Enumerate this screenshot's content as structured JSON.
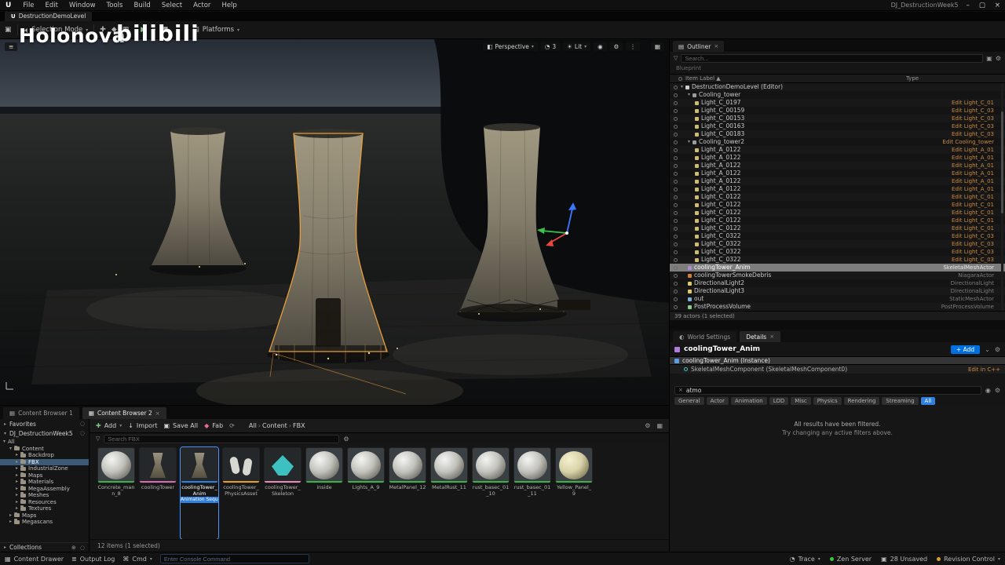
{
  "colors": {
    "accent": "#0070e0",
    "link_orange": "#cd8a3e",
    "selection_outline": "#f0a23c"
  },
  "menu_bar": {
    "items": [
      "File",
      "Edit",
      "Window",
      "Tools",
      "Build",
      "Select",
      "Actor",
      "Help"
    ],
    "project_label": "DJ_DestructionWeek5"
  },
  "level_tab": {
    "label": "DestructionDemoLevel"
  },
  "toolbar": {
    "selection_mode": "Selection Mode",
    "platforms": "Platforms"
  },
  "watermarks": {
    "left": "Holonova",
    "right": "bilibili"
  },
  "viewport": {
    "perspective": "Perspective",
    "camera_speed": "3",
    "lit": "Lit"
  },
  "outliner": {
    "tab": "Outliner",
    "search_placeholder": "Search...",
    "hint": "Blueprint",
    "columns": {
      "label": "Item Label ▲",
      "type": "Type"
    },
    "rows": [
      {
        "label": "DestructionDemoLevel (Editor)",
        "type": "",
        "indent": 0,
        "icon": "level",
        "caret": "▾"
      },
      {
        "label": "Cooling_tower",
        "type": "",
        "indent": 1,
        "icon": "group",
        "caret": "▾"
      },
      {
        "label": "Light_C_0197",
        "type": "Edit Light_C_01",
        "link": true,
        "indent": 2,
        "icon": "light"
      },
      {
        "label": "Light_C_00159",
        "type": "Edit Light_C_03",
        "link": true,
        "indent": 2,
        "icon": "light"
      },
      {
        "label": "Light_C_00153",
        "type": "Edit Light_C_03",
        "link": true,
        "indent": 2,
        "icon": "light"
      },
      {
        "label": "Light_C_00163",
        "type": "Edit Light_C_03",
        "link": true,
        "indent": 2,
        "icon": "light"
      },
      {
        "label": "Light_C_00183",
        "type": "Edit Light_C_03",
        "link": true,
        "indent": 2,
        "icon": "light"
      },
      {
        "label": "Cooling_tower2",
        "type": "Edit Cooling_tower",
        "link": true,
        "indent": 1,
        "icon": "group",
        "caret": "▾"
      },
      {
        "label": "Light_A_0122",
        "type": "Edit Light_A_01",
        "link": true,
        "indent": 2,
        "icon": "light"
      },
      {
        "label": "Light_A_0122",
        "type": "Edit Light_A_01",
        "link": true,
        "indent": 2,
        "icon": "light"
      },
      {
        "label": "Light_A_0122",
        "type": "Edit Light_A_01",
        "link": true,
        "indent": 2,
        "icon": "light"
      },
      {
        "label": "Light_A_0122",
        "type": "Edit Light_A_01",
        "link": true,
        "indent": 2,
        "icon": "light"
      },
      {
        "label": "Light_A_0122",
        "type": "Edit Light_A_01",
        "link": true,
        "indent": 2,
        "icon": "light"
      },
      {
        "label": "Light_A_0122",
        "type": "Edit Light_A_01",
        "link": true,
        "indent": 2,
        "icon": "light"
      },
      {
        "label": "Light_C_0122",
        "type": "Edit Light_C_01",
        "link": true,
        "indent": 2,
        "icon": "light"
      },
      {
        "label": "Light_C_0122",
        "type": "Edit Light_C_01",
        "link": true,
        "indent": 2,
        "icon": "light"
      },
      {
        "label": "Light_C_0122",
        "type": "Edit Light_C_01",
        "link": true,
        "indent": 2,
        "icon": "light"
      },
      {
        "label": "Light_C_0122",
        "type": "Edit Light_C_01",
        "link": true,
        "indent": 2,
        "icon": "light"
      },
      {
        "label": "Light_C_0122",
        "type": "Edit Light_C_01",
        "link": true,
        "indent": 2,
        "icon": "light"
      },
      {
        "label": "Light_C_0322",
        "type": "Edit Light_C_03",
        "link": true,
        "indent": 2,
        "icon": "light"
      },
      {
        "label": "Light_C_0322",
        "type": "Edit Light_C_03",
        "link": true,
        "indent": 2,
        "icon": "light"
      },
      {
        "label": "Light_C_0322",
        "type": "Edit Light_C_03",
        "link": true,
        "indent": 2,
        "icon": "light"
      },
      {
        "label": "Light_C_0322",
        "type": "Edit Light_C_03",
        "link": true,
        "indent": 2,
        "icon": "light"
      },
      {
        "label": "coolingTower_Anim",
        "type": "SkeletalMeshActor",
        "indent": 1,
        "icon": "skm",
        "selected": true
      },
      {
        "label": "coolingTowerSmokeDebris",
        "type": "NiagaraActor",
        "indent": 1,
        "icon": "fx"
      },
      {
        "label": "DirectionalLight2",
        "type": "DirectionalLight",
        "indent": 1,
        "icon": "dlight"
      },
      {
        "label": "DirectionalLight3",
        "type": "DirectionalLight",
        "indent": 1,
        "icon": "dlight"
      },
      {
        "label": "out",
        "type": "StaticMeshActor",
        "indent": 1,
        "icon": "mesh"
      },
      {
        "label": "PostProcessVolume",
        "type": "PostProcessVolume",
        "indent": 1,
        "icon": "pp"
      }
    ],
    "footer": "39 actors (1 selected)"
  },
  "details": {
    "tab_world": "World Settings",
    "tab_details": "Details",
    "title": "coolingTower_Anim",
    "add_button": "+ Add",
    "instance_row": "coolingTower_Anim (Instance)",
    "component_row": "SkeletalMeshComponent (SkeletalMeshComponent0)",
    "edit_link": "Edit in C++",
    "search_value": "atmo",
    "filters": [
      "General",
      "Actor",
      "Animation",
      "LOD",
      "Misc",
      "Physics",
      "Rendering",
      "Streaming",
      "All"
    ],
    "active_filter": "All",
    "empty_line1": "All results have been filtered.",
    "empty_line2": "Try changing any active filters above."
  },
  "content_browser": {
    "tab1": "Content Browser 1",
    "tab2": "Content Browser 2",
    "favorites": "Favorites",
    "project_root": "DJ_DestructionWeek5",
    "folders": [
      {
        "label": "All",
        "indent": 0,
        "caret": "▾"
      },
      {
        "label": "Content",
        "indent": 1,
        "caret": "▾",
        "folder": true
      },
      {
        "label": "Backdrop",
        "indent": 2,
        "folder": true
      },
      {
        "label": "FBX",
        "indent": 2,
        "folder": true,
        "selected": true
      },
      {
        "label": "IndustrialZone",
        "indent": 2,
        "folder": true
      },
      {
        "label": "Maps",
        "indent": 2,
        "folder": true
      },
      {
        "label": "Materials",
        "indent": 2,
        "folder": true
      },
      {
        "label": "MegaAssembly",
        "indent": 2,
        "folder": true
      },
      {
        "label": "Meshes",
        "indent": 2,
        "folder": true
      },
      {
        "label": "Resources",
        "indent": 2,
        "folder": true
      },
      {
        "label": "Textures",
        "indent": 2,
        "folder": true
      },
      {
        "label": "Maps",
        "indent": 1,
        "folder": true
      },
      {
        "label": "Megascans",
        "indent": 1,
        "folder": true
      }
    ],
    "collections": "Collections",
    "toolbar": {
      "add": "Add",
      "import": "Import",
      "save_all": "Save All",
      "fab": "Fab"
    },
    "breadcrumb": [
      "All",
      "Content",
      "FBX"
    ],
    "search_placeholder": "Search FBX",
    "assets": [
      {
        "name": "Concrete_mann_8",
        "kind": "sphere",
        "bar": "#3fae46"
      },
      {
        "name": "coolingTower",
        "kind": "tower",
        "bar": "#d86ab0"
      },
      {
        "name": "coolingTower_Anim",
        "kind": "tower",
        "bar": "#2f80e0",
        "selected": true
      },
      {
        "name": "coolingTower_PhysicsAsset",
        "kind": "physics",
        "bar": "#e0a030"
      },
      {
        "name": "coolingTower_Skeleton",
        "kind": "skeleton",
        "bar": "#e88ab8"
      },
      {
        "name": "inside",
        "kind": "sphere",
        "bar": "#3fae46"
      },
      {
        "name": "Lights_A_9",
        "kind": "sphere",
        "bar": "#3fae46"
      },
      {
        "name": "MetalPanel_12",
        "kind": "sphere",
        "bar": "#3fae46"
      },
      {
        "name": "MetalRust_11",
        "kind": "sphere",
        "bar": "#3fae46"
      },
      {
        "name": "rust_basec_01_10",
        "kind": "sphere",
        "bar": "#3fae46"
      },
      {
        "name": "rust_basec_01_11",
        "kind": "sphere",
        "bar": "#3fae46"
      },
      {
        "name": "Yellow_Panel_9",
        "kind": "sphere-yellow",
        "bar": "#3fae46"
      }
    ],
    "selected_asset_type": "Animation Sequence",
    "footer": "12 items (1 selected)"
  },
  "status_bar": {
    "content_drawer": "Content Drawer",
    "output_log": "Output Log",
    "cmd": "Cmd",
    "console_placeholder": "Enter Console Command",
    "trace": "Trace",
    "zen": "Zen Server",
    "unsaved": "28 Unsaved",
    "revision": "Revision Control"
  }
}
